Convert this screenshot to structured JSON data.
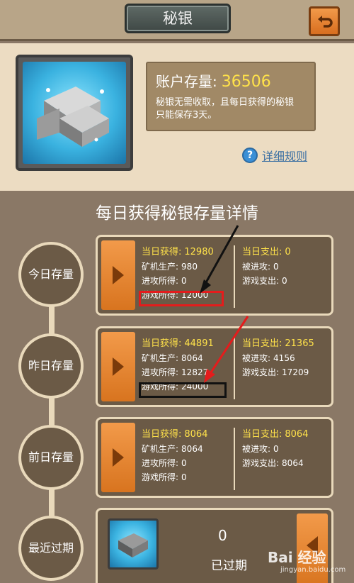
{
  "header": {
    "title": "秘银"
  },
  "account": {
    "label": "账户存量:",
    "value": "36506",
    "desc_line1": "秘银无需收取，且每日获得的秘银",
    "desc_line2": "只能保存3天。",
    "rules_link": "详细规则"
  },
  "section_title": "每日获得秘银存量详情",
  "days": [
    {
      "label": "今日存量",
      "gain_label": "当日获得:",
      "gain_value": "12980",
      "mine_label": "矿机生产:",
      "mine_value": "980",
      "attack_gain_label": "进攻所得:",
      "attack_gain_value": "0",
      "game_gain_label": "游戏所得:",
      "game_gain_value": "12000",
      "spend_label": "当日支出:",
      "spend_value": "0",
      "attacked_label": "被进攻:",
      "attacked_value": "0",
      "game_spend_label": "游戏支出:",
      "game_spend_value": "0"
    },
    {
      "label": "昨日存量",
      "gain_label": "当日获得:",
      "gain_value": "44891",
      "mine_label": "矿机生产:",
      "mine_value": "8064",
      "attack_gain_label": "进攻所得:",
      "attack_gain_value": "12827",
      "game_gain_label": "游戏所得:",
      "game_gain_value": "24000",
      "spend_label": "当日支出:",
      "spend_value": "21365",
      "attacked_label": "被进攻:",
      "attacked_value": "4156",
      "game_spend_label": "游戏支出:",
      "game_spend_value": "17209"
    },
    {
      "label": "前日存量",
      "gain_label": "当日获得:",
      "gain_value": "8064",
      "mine_label": "矿机生产:",
      "mine_value": "8064",
      "attack_gain_label": "进攻所得:",
      "attack_gain_value": "0",
      "game_gain_label": "游戏所得:",
      "game_gain_value": "0",
      "spend_label": "当日支出:",
      "spend_value": "8064",
      "attacked_label": "被进攻:",
      "attacked_value": "0",
      "game_spend_label": "游戏支出:",
      "game_spend_value": "8064"
    }
  ],
  "expired": {
    "label": "最近过期",
    "count": "0",
    "status": "已过期"
  },
  "watermark": {
    "brand": "Bai 经验",
    "url": "jingyan.baidu.com"
  },
  "colors": {
    "highlight_red": "#e41c1c",
    "highlight_black": "#111111",
    "accent_yellow": "#ffe24a",
    "button_orange": "#f29a4a"
  },
  "icons": [
    "back-arrow-icon",
    "help-icon",
    "silver-ingot-icon",
    "play-arrow-icon"
  ]
}
